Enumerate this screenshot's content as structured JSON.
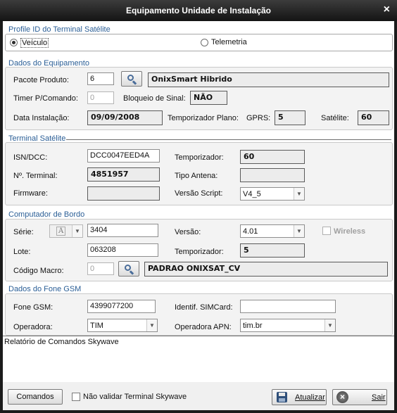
{
  "window": {
    "title": "Equipamento Unidade de Instalação",
    "close_glyph": "×"
  },
  "profile": {
    "section_title": "Profile ID do Terminal Satélite",
    "options": [
      {
        "label": "Veículo",
        "selected": true
      },
      {
        "label": "Telemetria",
        "selected": false
      }
    ]
  },
  "equipamento": {
    "section_title": "Dados do Equipamento",
    "pacote_label": "Pacote Produto:",
    "pacote_value": "6",
    "pacote_name": "OnixSmart Hibrido",
    "timer_label": "Timer P/Comando:",
    "timer_value": "0",
    "bloqueio_label": "Bloqueio de Sinal:",
    "bloqueio_value": "NÃO",
    "data_label": "Data Instalação:",
    "data_value": "09/09/2008",
    "temp_plano_label": "Temporizador Plano:",
    "gprs_label": "GPRS:",
    "gprs_value": "5",
    "satelite_label": "Satélite:",
    "satelite_value": "60"
  },
  "terminal": {
    "section_title": "Terminal Satélite",
    "isn_label": "ISN/DCC:",
    "isn_value": "DCC0047EED4A",
    "temporizador_label": "Temporizador:",
    "temporizador_value": "60",
    "numero_label": "Nº. Terminal:",
    "numero_value": "4851957",
    "antena_label": "Tipo Antena:",
    "antena_value": "",
    "firmware_label": "Firmware:",
    "firmware_value": "",
    "script_label": "Versão Script:",
    "script_value": "V4_5"
  },
  "computador": {
    "section_title": "Computador de Bordo",
    "serie_label": "Série:",
    "serie_code": "A",
    "serie_value": "3404",
    "versao_label": "Versão:",
    "versao_value": "4.01",
    "wireless_label": "Wireless",
    "lote_label": "Lote:",
    "lote_value": "063208",
    "temporizador_label": "Temporizador:",
    "temporizador_value": "5",
    "macro_label": "Código Macro:",
    "macro_value": "0",
    "macro_name": "PADRAO ONIXSAT_CV"
  },
  "gsm": {
    "section_title": "Dados do Fone GSM",
    "fone_label": "Fone GSM:",
    "fone_value": "4399077200",
    "simcard_label": "Identif. SIMCard:",
    "simcard_value": "",
    "operadora_label": "Operadora:",
    "operadora_value": "TIM",
    "apn_label": "Operadora APN:",
    "apn_value": "tim.br"
  },
  "relatorio": {
    "text": "Relatório de Comandos Skywave"
  },
  "footer": {
    "comandos_label": "Comandos",
    "nao_validar_label": "Não validar Terminal Skywave",
    "atualizar_label": "Atualizar",
    "sair_label": "Sair"
  },
  "icons": {
    "save": "floppy-disk-icon",
    "exit": "exit-x-icon",
    "search": "magnifier-icon",
    "dropdown": "chevron-down-icon"
  },
  "colors": {
    "section_title": "#2a5e96",
    "titlebar": "#1b1b1b"
  }
}
